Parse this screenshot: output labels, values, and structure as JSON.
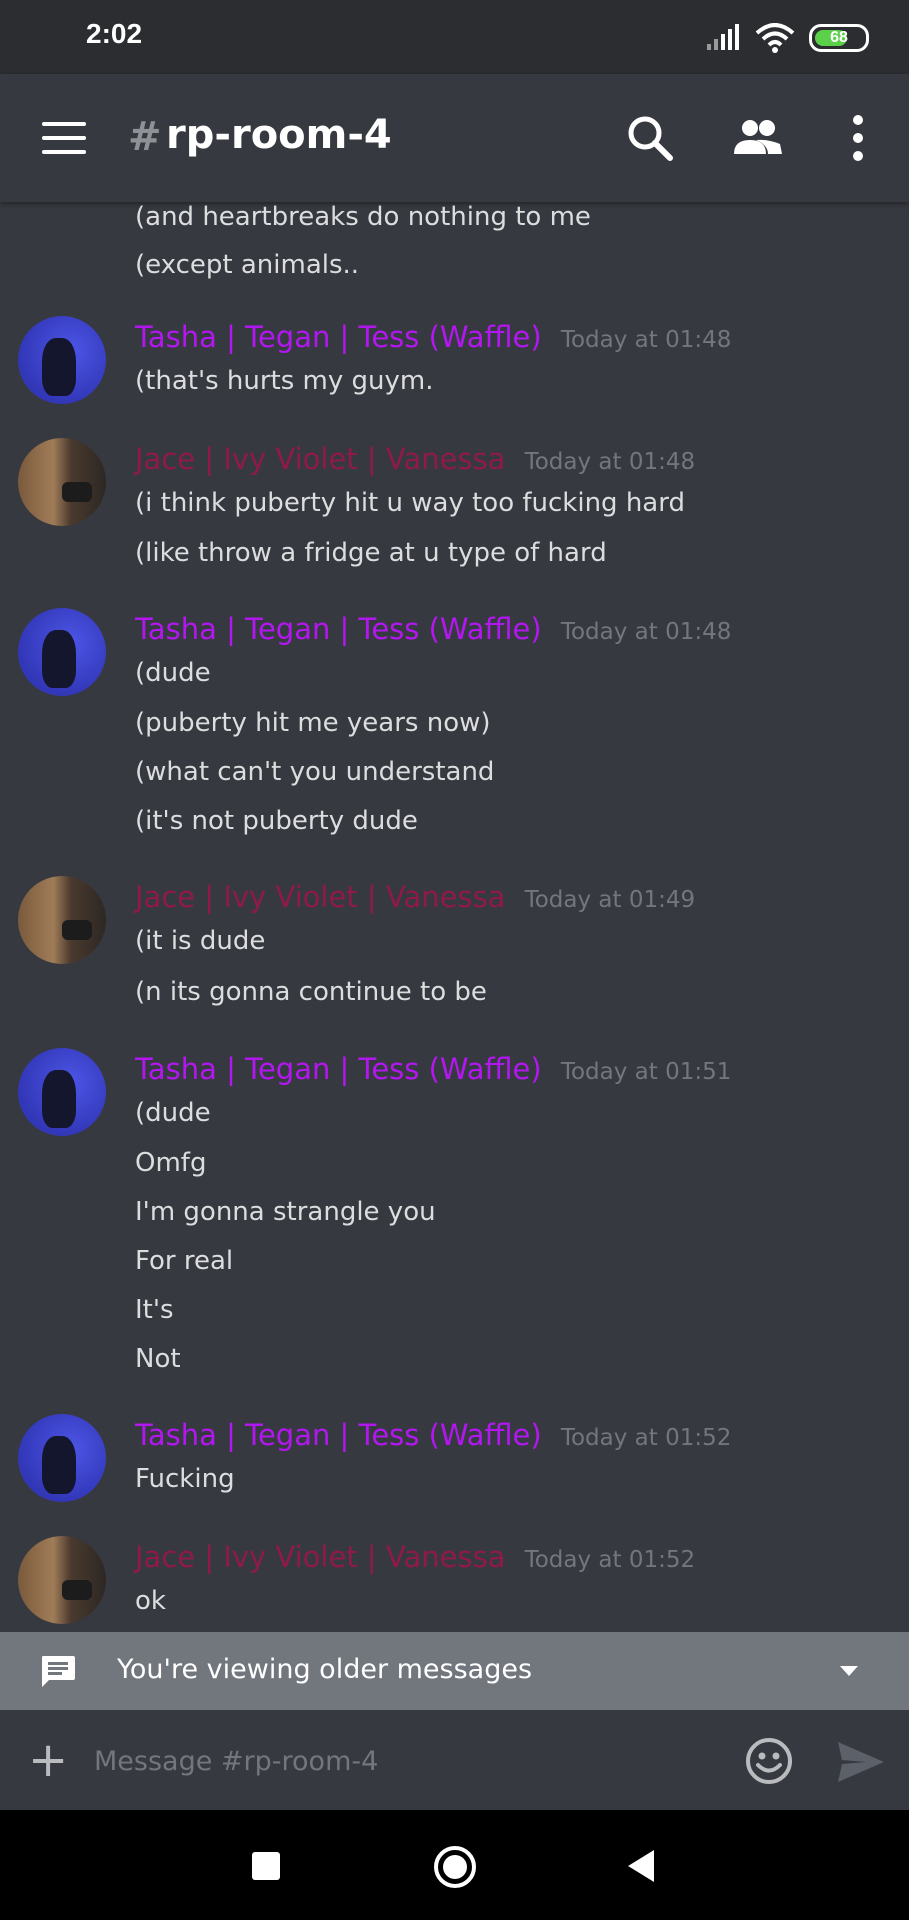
{
  "status_bar": {
    "time": "2:02",
    "battery": "68"
  },
  "header": {
    "hash": "#",
    "channel": "rp-room-4"
  },
  "messages": {
    "lines": [
      "(and heartbreaks do nothing to me",
      "(except animals..",
      "(that's hurts my guym.",
      "(i think puberty hit u way too fucking hard",
      "(like throw a fridge at u type of hard",
      "(dude",
      "(puberty hit me years now)",
      "(what can't you understand",
      "(it's not puberty dude",
      "(it is dude",
      "(n its gonna continue to be",
      "(dude",
      "Omfg",
      "I'm gonna strangle you",
      "For real",
      "It's",
      "Not",
      "Fucking",
      "ok"
    ],
    "groups": [
      {
        "author": "Tasha | Tegan | Tess (Waffle)",
        "timestamp": "Today at 01:48"
      },
      {
        "author": "Jace | Ivy Violet | Vanessa",
        "timestamp": "Today at 01:48"
      },
      {
        "author": "Tasha | Tegan | Tess (Waffle)",
        "timestamp": "Today at 01:48"
      },
      {
        "author": "Jace | Ivy Violet | Vanessa",
        "timestamp": "Today at 01:49"
      },
      {
        "author": "Tasha | Tegan | Tess (Waffle)",
        "timestamp": "Today at 01:51"
      },
      {
        "author": "Tasha | Tegan | Tess (Waffle)",
        "timestamp": "Today at 01:52"
      },
      {
        "author": "Jace | Ivy Violet | Vanessa",
        "timestamp": "Today at 01:52"
      }
    ]
  },
  "older_banner": {
    "label": "You're viewing older messages"
  },
  "composer": {
    "placeholder": "Message #rp-room-4"
  },
  "colors": {
    "tasha_name": "#b317f0",
    "jace_name": "#8f1a4a",
    "background": "#36393f"
  }
}
